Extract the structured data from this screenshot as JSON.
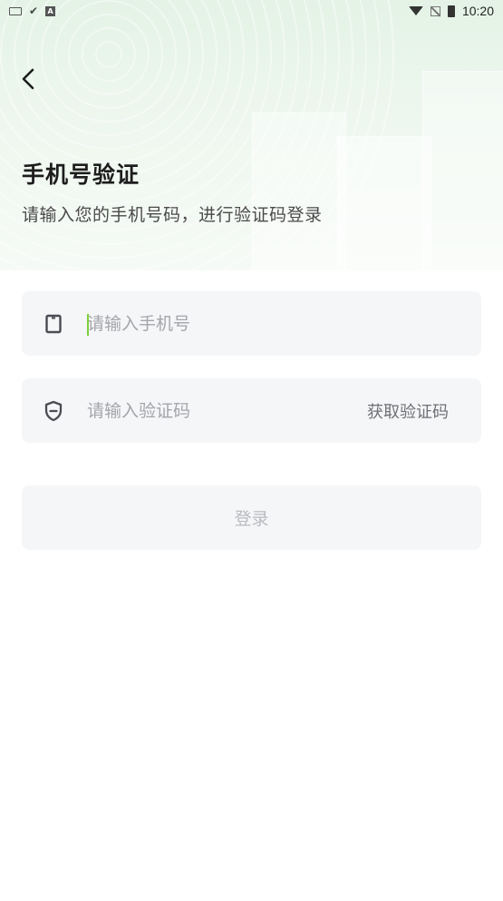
{
  "status_bar": {
    "time": "10:20",
    "left_icons": [
      "keyboard-icon",
      "checkmark-icon",
      "a-badge-icon"
    ],
    "right_icons": [
      "wifi-icon",
      "no-sim-icon",
      "battery-icon"
    ]
  },
  "header": {
    "back_icon": "chevron-left-icon",
    "title": "手机号验证",
    "subtitle": "请输入您的手机号码，进行验证码登录"
  },
  "form": {
    "phone": {
      "icon": "phone-icon",
      "placeholder": "请输入手机号",
      "value": ""
    },
    "code": {
      "icon": "shield-icon",
      "placeholder": "请输入验证码",
      "value": "",
      "action_label": "获取验证码"
    },
    "submit_label": "登录"
  },
  "colors": {
    "hero_gradient_top": "#e4f3e6",
    "field_bg": "#f5f6f8",
    "cursor": "#7ccf3a",
    "placeholder": "#a3a5aa",
    "disabled_text": "#b9bbc0"
  }
}
